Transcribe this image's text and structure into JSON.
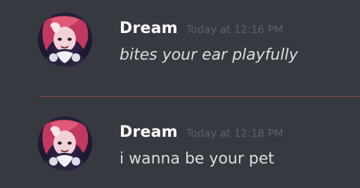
{
  "messages": [
    {
      "author": "Dream",
      "timestamp": "Today at 12:16 PM",
      "text": "bites your ear playfully",
      "italic": true
    },
    {
      "author": "Dream",
      "timestamp": "Today at 12:18 PM",
      "text": "i wanna be your pet",
      "italic": false
    }
  ],
  "colors": {
    "background": "#36393f",
    "username": "#ffffff",
    "timestamp": "#5f6166",
    "message_text": "#dcddde",
    "divider": "#a04a46"
  }
}
